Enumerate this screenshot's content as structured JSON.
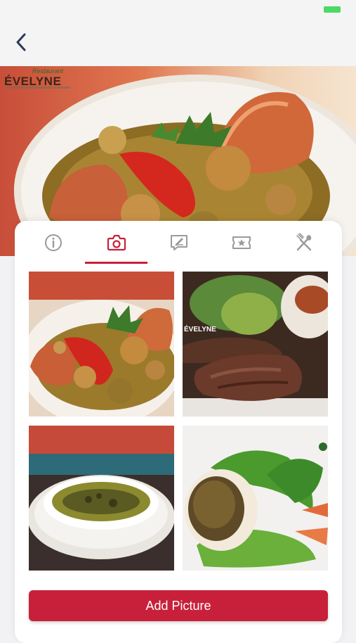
{
  "header": {
    "back_icon": "chevron-left-icon"
  },
  "hero": {
    "logo_small": "Restaurant",
    "logo_name": "ÉVELYNE"
  },
  "tabs": [
    {
      "icon": "info-icon",
      "active": false
    },
    {
      "icon": "camera-icon",
      "active": true
    },
    {
      "icon": "review-icon",
      "active": false
    },
    {
      "icon": "ticket-icon",
      "active": false
    },
    {
      "icon": "utensils-icon",
      "active": false
    }
  ],
  "gallery": {
    "photos": [
      "lobster-dish",
      "grilled-steak",
      "soup-bowl",
      "stuffed-avocado-salad"
    ],
    "photo2_logo": "ÉVELYNE"
  },
  "actions": {
    "add_picture_label": "Add Picture"
  },
  "colors": {
    "accent": "#c8203a",
    "icon_gray": "#9a9a9a",
    "status_green": "#4cd964"
  }
}
